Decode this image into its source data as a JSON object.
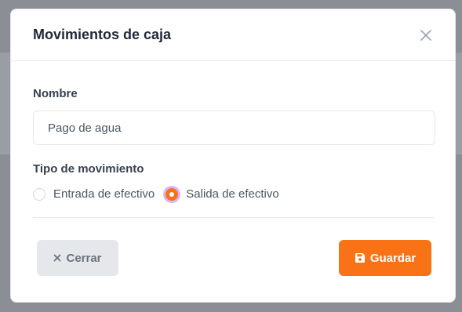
{
  "modal": {
    "title": "Movimientos de caja",
    "close_icon": "close-icon"
  },
  "form": {
    "name_label": "Nombre",
    "name_value": "Pago de agua",
    "type_label": "Tipo de movimiento",
    "movement_types": [
      {
        "label": "Entrada de efectivo",
        "selected": false
      },
      {
        "label": "Salida de efectivo",
        "selected": true
      }
    ]
  },
  "footer": {
    "cancel_label": "Cerrar",
    "cancel_icon": "x-icon",
    "save_label": "Guardar",
    "save_icon": "save-icon"
  },
  "colors": {
    "accent": "#f97316",
    "focus_ring": "#d8b4fe",
    "cancel_bg": "#e5e7eb"
  }
}
